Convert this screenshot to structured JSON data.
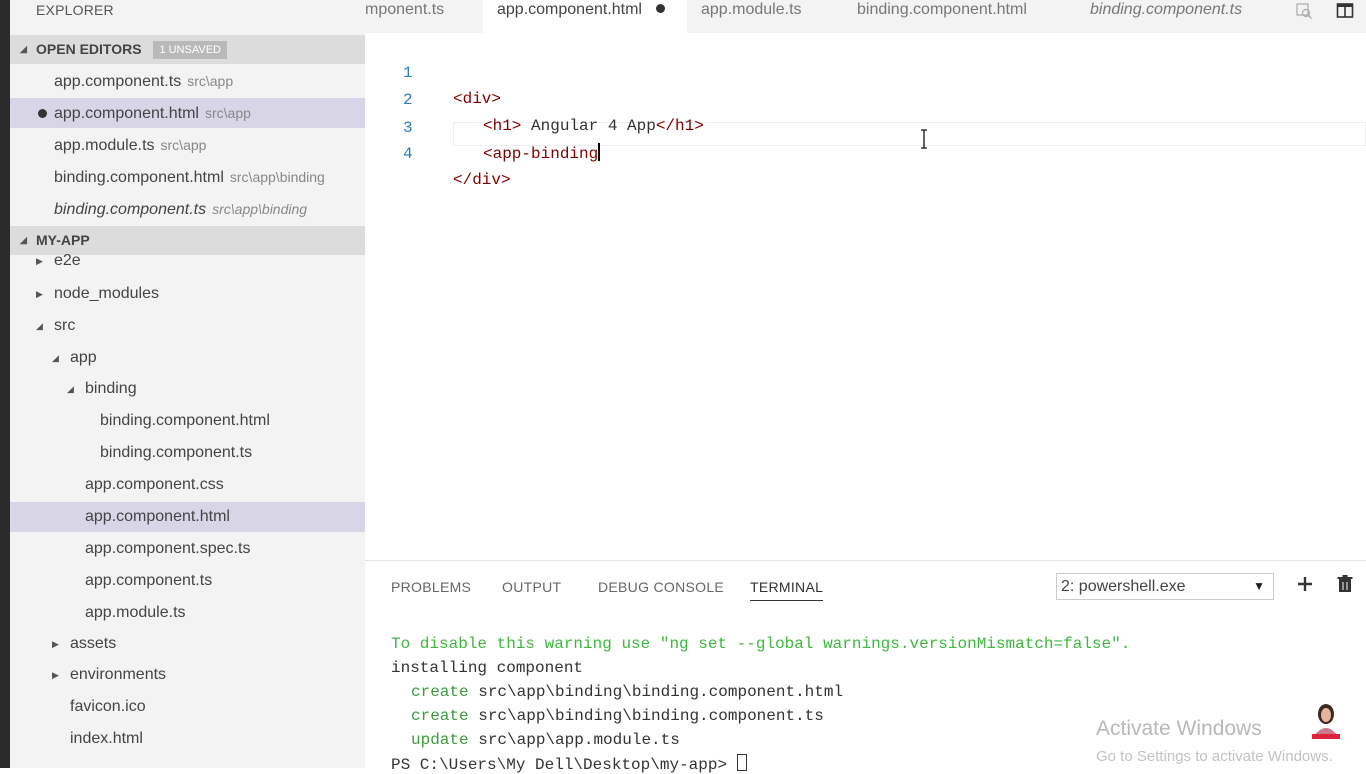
{
  "sidebar": {
    "title": "EXPLORER",
    "open_editors": {
      "label": "OPEN EDITORS",
      "badge": "1 UNSAVED",
      "items": [
        {
          "name": "app.component.ts",
          "path": "src\\app"
        },
        {
          "name": "app.component.html",
          "path": "src\\app"
        },
        {
          "name": "app.module.ts",
          "path": "src\\app"
        },
        {
          "name": "binding.component.html",
          "path": "src\\app\\binding"
        },
        {
          "name": "binding.component.ts",
          "path": "src\\app\\binding"
        }
      ]
    },
    "project": {
      "label": "MY-APP",
      "tree": [
        {
          "name": "e2e"
        },
        {
          "name": "node_modules"
        },
        {
          "name": "src"
        },
        {
          "name": "app"
        },
        {
          "name": "binding"
        },
        {
          "name": "binding.component.html"
        },
        {
          "name": "binding.component.ts"
        },
        {
          "name": "app.component.css"
        },
        {
          "name": "app.component.html"
        },
        {
          "name": "app.component.spec.ts"
        },
        {
          "name": "app.component.ts"
        },
        {
          "name": "app.module.ts"
        },
        {
          "name": "assets"
        },
        {
          "name": "environments"
        },
        {
          "name": "favicon.ico"
        },
        {
          "name": "index.html"
        }
      ]
    }
  },
  "tabs": [
    {
      "label": "mponent.ts"
    },
    {
      "label": "app.component.html"
    },
    {
      "label": "app.module.ts"
    },
    {
      "label": "binding.component.html"
    },
    {
      "label": "binding.component.ts"
    }
  ],
  "tab_icons": [
    "open-preview-icon",
    "split-editor-icon"
  ],
  "editor": {
    "lines": [
      {
        "num": "1",
        "t1": "<div>",
        "t2": "",
        "t3": ""
      },
      {
        "num": "2",
        "t1": "<h1>",
        "t2": " Angular 4 App",
        "t3": "</h1>"
      },
      {
        "num": "3",
        "t1": "<app-binding",
        "t2": "",
        "t3": ""
      },
      {
        "num": "4",
        "t1": "</div>",
        "t2": "",
        "t3": ""
      }
    ]
  },
  "panel": {
    "tabs": [
      "PROBLEMS",
      "OUTPUT",
      "DEBUG CONSOLE",
      "TERMINAL"
    ],
    "active_tab": "TERMINAL",
    "shell_select": "2: powershell.exe",
    "terminal": {
      "warning": "To disable this warning use \"ng set --global warnings.versionMismatch=false\".",
      "installing": "installing component",
      "ops": [
        {
          "op": "create",
          "path": "src\\app\\binding\\binding.component.html"
        },
        {
          "op": "create",
          "path": "src\\app\\binding\\binding.component.ts"
        },
        {
          "op": "update",
          "path": "src\\app\\app.module.ts"
        }
      ],
      "prompt": "PS C:\\Users\\My Dell\\Desktop\\my-app> "
    }
  },
  "watermark": {
    "line1": "Activate Windows",
    "line2": "Go to Settings to activate Windows."
  },
  "colors": {
    "accent_line_number": "#2b7dbc",
    "tag": "#800000",
    "terminal_green": "#3c9b3c",
    "selection": "#d8d6e6"
  }
}
